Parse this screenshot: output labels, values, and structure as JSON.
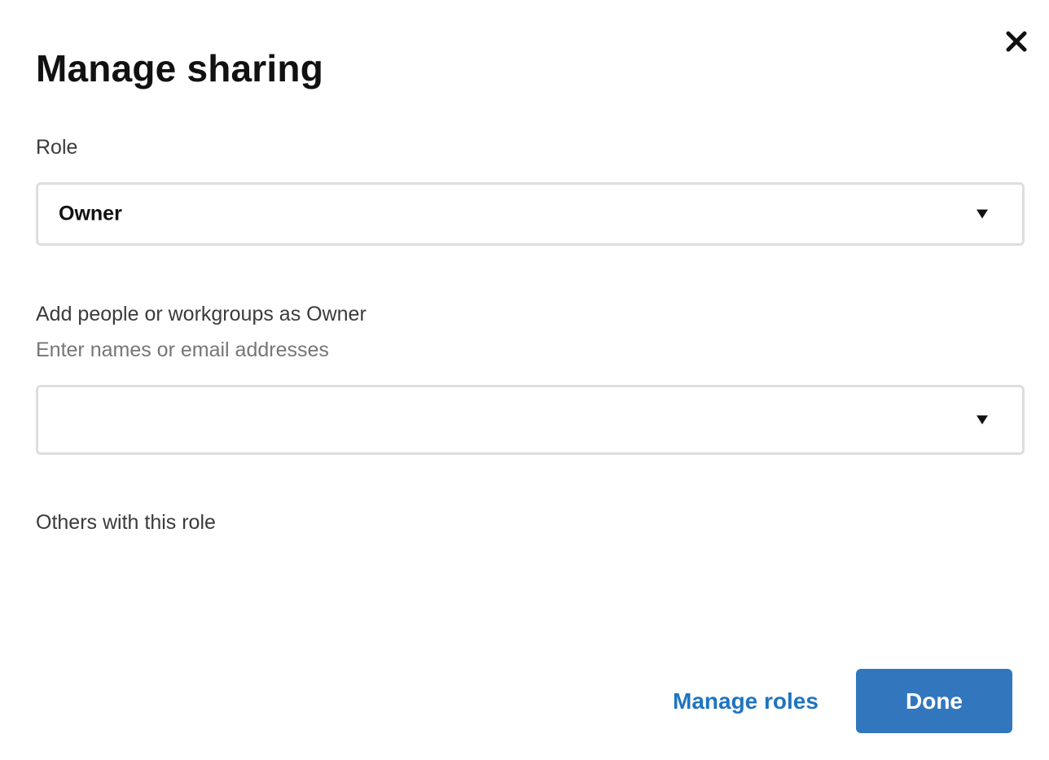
{
  "dialog": {
    "title": "Manage sharing",
    "close_icon": "close-icon"
  },
  "role": {
    "label": "Role",
    "selected": "Owner",
    "caret_icon": "caret-down-icon"
  },
  "add_people": {
    "label": "Add people or workgroups as Owner",
    "hint": "Enter names or email addresses",
    "value": "",
    "caret_icon": "caret-down-icon"
  },
  "others": {
    "label": "Others with this role"
  },
  "footer": {
    "manage_roles_label": "Manage roles",
    "done_label": "Done"
  },
  "colors": {
    "primary_button": "#3277be",
    "link": "#1f74c0",
    "field_border": "#dedede"
  }
}
